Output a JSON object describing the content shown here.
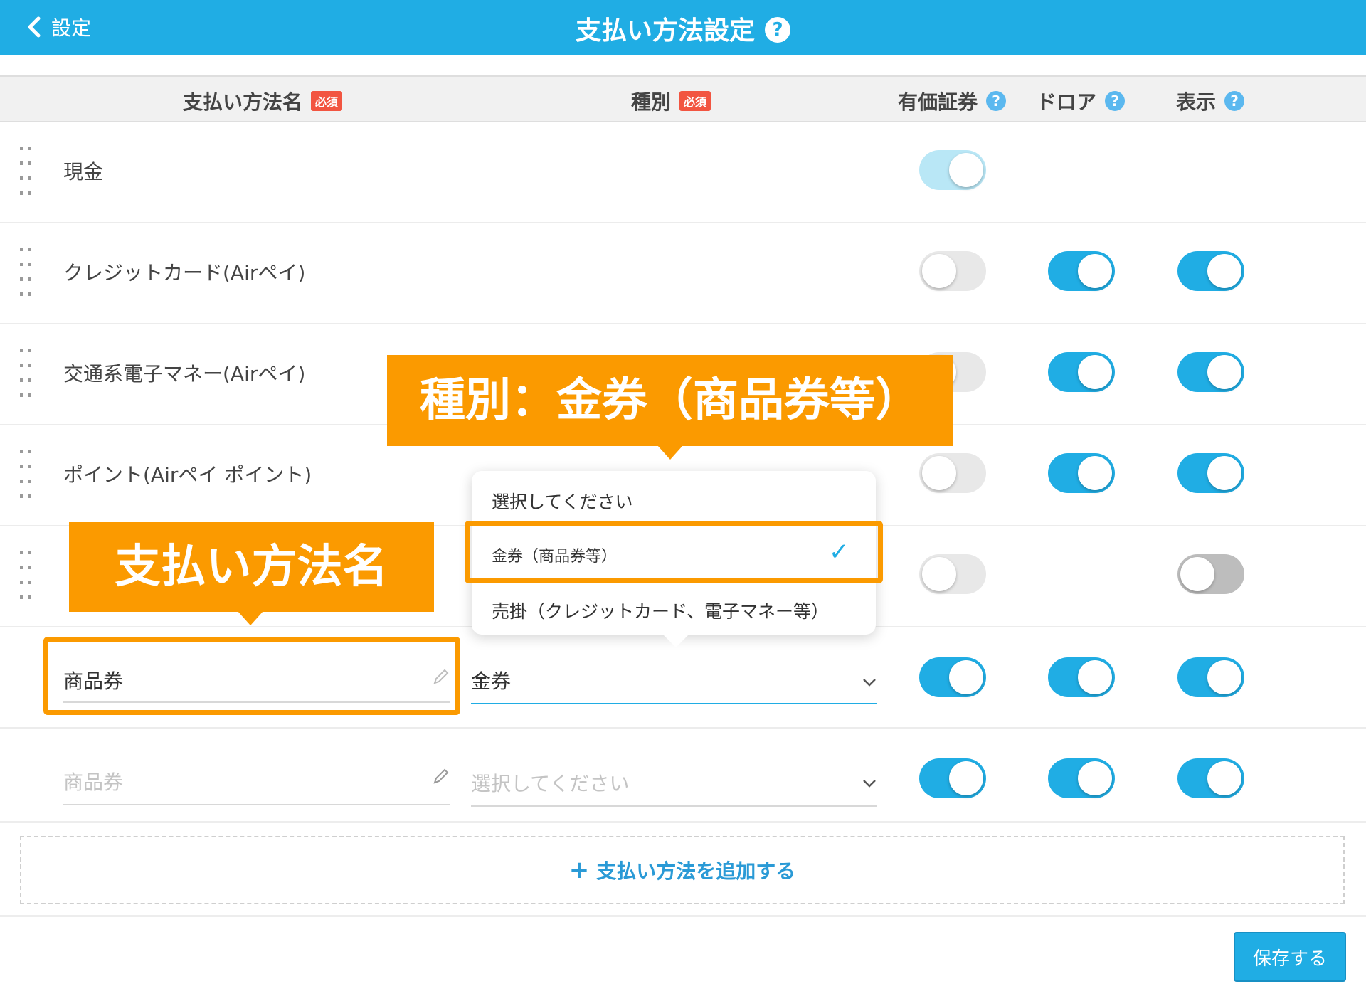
{
  "header": {
    "back_label": "設定",
    "title": "支払い方法設定",
    "help_glyph": "?"
  },
  "columns": {
    "name": "支払い方法名",
    "type": "種別",
    "required": "必須",
    "securities": "有価証券",
    "drawer": "ドロア",
    "display": "表示",
    "help_glyph": "?"
  },
  "rows": [
    {
      "name": "現金",
      "securities": "on-light",
      "drawer": null,
      "display": null
    },
    {
      "name": "クレジットカード(Airペイ)",
      "securities": "off",
      "drawer": "on",
      "display": "on"
    },
    {
      "name": "交通系電子マネー(Airペイ)",
      "securities": "off",
      "drawer": "on",
      "display": "on"
    },
    {
      "name": "ポイント(Airペイ ポイント)",
      "securities": "off",
      "drawer": "on",
      "display": "on"
    },
    {
      "name": "",
      "securities": "off",
      "drawer": null,
      "display": "off-dark"
    }
  ],
  "edit_row": {
    "name_value": "商品券",
    "type_value": "金券"
  },
  "new_row": {
    "name_placeholder": "商品券",
    "type_placeholder": "選択してください"
  },
  "dropdown": {
    "options": [
      "選択してください",
      "金券（商品券等）",
      "売掛（クレジットカード、電子マネー等）"
    ],
    "selected_index": 1,
    "check_glyph": "✓"
  },
  "add_button_label": "支払い方法を追加する",
  "add_glyph": "+",
  "save_button_label": "保存する",
  "callouts": {
    "type": "種別：金券（商品券等）",
    "name": "支払い方法名"
  },
  "colors": {
    "accent": "#20ade4",
    "callout": "#fb9a00",
    "required_badge": "#f25541"
  }
}
